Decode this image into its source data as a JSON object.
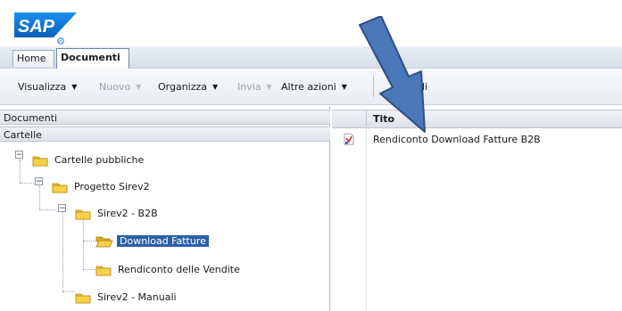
{
  "app": {
    "logo_text": "SAP"
  },
  "tabs": [
    {
      "label": "Home",
      "active": false
    },
    {
      "label": "Documenti",
      "active": true
    }
  ],
  "toolbar": {
    "items": [
      {
        "label": "Visualizza",
        "enabled": true,
        "has_menu": true
      },
      {
        "label": "Nuovo",
        "enabled": false,
        "has_menu": true
      },
      {
        "label": "Organizza",
        "enabled": true,
        "has_menu": true
      },
      {
        "label": "Invia",
        "enabled": false,
        "has_menu": true
      },
      {
        "label": "Altre azioni",
        "enabled": true,
        "has_menu": true
      },
      {
        "label": "gli",
        "enabled": true,
        "has_menu": false
      }
    ]
  },
  "left_panel": {
    "section_documenti": "Documenti",
    "section_cartelle": "Cartelle",
    "tree": [
      {
        "label": "Cartelle pubbliche",
        "expanded": true
      },
      {
        "label": "Progetto Sirev2",
        "expanded": true
      },
      {
        "label": "Sirev2 - B2B",
        "expanded": true
      },
      {
        "label": "Download Fatture",
        "selected": true,
        "icon": "open-folder-icon"
      },
      {
        "label": "Rendiconto delle Vendite",
        "icon": "folder-icon"
      },
      {
        "label": "Sirev2 - Manuali",
        "icon": "folder-icon"
      }
    ]
  },
  "right_panel": {
    "column_title": "Tito",
    "rows": [
      {
        "icon": "report-document-icon",
        "title": "Rendiconto Download Fatture B2B"
      }
    ]
  },
  "colors": {
    "sap_blue": "#0a6bd1",
    "selection": "#2c60a8",
    "folder": "#f2c230",
    "arrow_fill": "#4a78b8",
    "arrow_stroke": "#2e4f82"
  },
  "annotation": {
    "icon": "callout-arrow-icon"
  }
}
